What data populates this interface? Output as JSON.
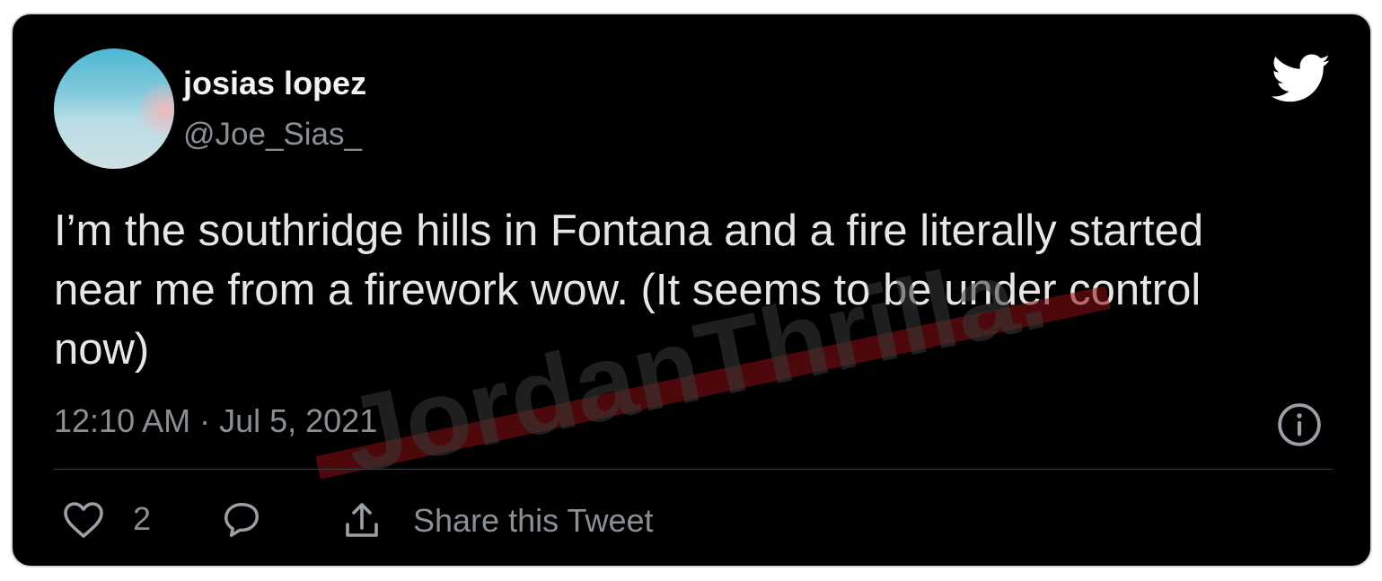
{
  "user": {
    "display_name": "josias lopez",
    "handle": "@Joe_Sias_"
  },
  "tweet": {
    "text": "I’m the southridge hills in Fontana and a fire literally started near me from a firework wow. (It seems to be under control now)",
    "timestamp": "12:10 AM · Jul 5, 2021"
  },
  "actions": {
    "like_count": "2",
    "share_label": "Share this Tweet"
  },
  "watermark": {
    "text": "JordanThrilla."
  },
  "icons": {
    "brand": "twitter-bird-icon",
    "info": "info-icon",
    "like": "heart-icon",
    "reply": "reply-icon",
    "share": "share-icon"
  },
  "colors": {
    "background": "#000000",
    "text": "#e6e6e6",
    "muted": "#8a8f94",
    "watermark_line": "#8b0f14"
  }
}
